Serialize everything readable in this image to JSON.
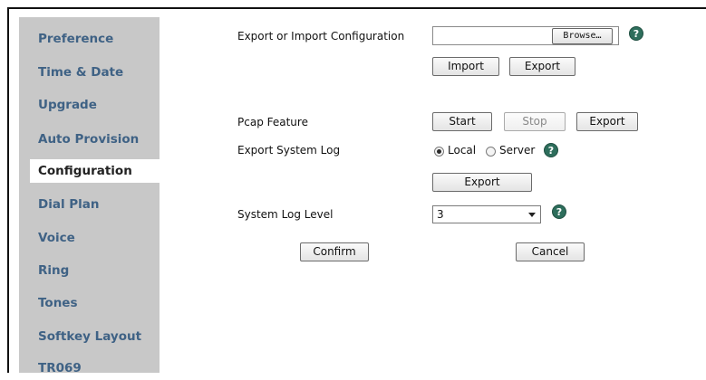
{
  "sidebar": {
    "items": [
      {
        "label": "Preference"
      },
      {
        "label": "Time & Date"
      },
      {
        "label": "Upgrade"
      },
      {
        "label": "Auto Provision"
      },
      {
        "label": "Configuration"
      },
      {
        "label": "Dial Plan"
      },
      {
        "label": "Voice"
      },
      {
        "label": "Ring"
      },
      {
        "label": "Tones"
      },
      {
        "label": "Softkey Layout"
      },
      {
        "label": "TR069"
      }
    ],
    "active": "Configuration"
  },
  "config_io": {
    "label": "Export or Import Configuration",
    "file_value": "",
    "browse_label": "Browse…",
    "import_label": "Import",
    "export_label": "Export"
  },
  "pcap": {
    "label": "Pcap Feature",
    "start_label": "Start",
    "stop_label": "Stop",
    "export_label": "Export"
  },
  "system_log": {
    "label": "Export System Log",
    "local_label": "Local",
    "server_label": "Server",
    "selected": "Local",
    "export_label": "Export"
  },
  "log_level": {
    "label": "System Log Level",
    "value": "3"
  },
  "footer": {
    "confirm_label": "Confirm",
    "cancel_label": "Cancel"
  },
  "help_glyph": "?",
  "colors": {
    "sidebar_bg": "#c8c8c8",
    "nav_text": "#3f6285",
    "help_icon": "#2e6e5c"
  }
}
